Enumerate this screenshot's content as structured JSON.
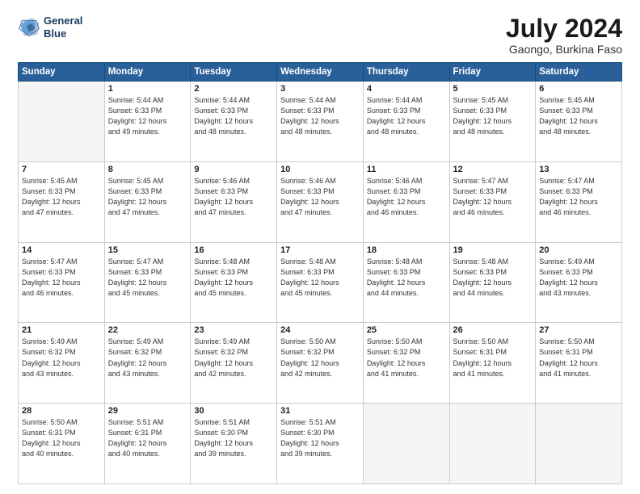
{
  "header": {
    "logo_line1": "General",
    "logo_line2": "Blue",
    "title": "July 2024",
    "subtitle": "Gaongo, Burkina Faso"
  },
  "calendar": {
    "headers": [
      "Sunday",
      "Monday",
      "Tuesday",
      "Wednesday",
      "Thursday",
      "Friday",
      "Saturday"
    ],
    "rows": [
      [
        {
          "day": "",
          "info": ""
        },
        {
          "day": "1",
          "info": "Sunrise: 5:44 AM\nSunset: 6:33 PM\nDaylight: 12 hours\nand 49 minutes."
        },
        {
          "day": "2",
          "info": "Sunrise: 5:44 AM\nSunset: 6:33 PM\nDaylight: 12 hours\nand 48 minutes."
        },
        {
          "day": "3",
          "info": "Sunrise: 5:44 AM\nSunset: 6:33 PM\nDaylight: 12 hours\nand 48 minutes."
        },
        {
          "day": "4",
          "info": "Sunrise: 5:44 AM\nSunset: 6:33 PM\nDaylight: 12 hours\nand 48 minutes."
        },
        {
          "day": "5",
          "info": "Sunrise: 5:45 AM\nSunset: 6:33 PM\nDaylight: 12 hours\nand 48 minutes."
        },
        {
          "day": "6",
          "info": "Sunrise: 5:45 AM\nSunset: 6:33 PM\nDaylight: 12 hours\nand 48 minutes."
        }
      ],
      [
        {
          "day": "7",
          "info": "Sunrise: 5:45 AM\nSunset: 6:33 PM\nDaylight: 12 hours\nand 47 minutes."
        },
        {
          "day": "8",
          "info": "Sunrise: 5:45 AM\nSunset: 6:33 PM\nDaylight: 12 hours\nand 47 minutes."
        },
        {
          "day": "9",
          "info": "Sunrise: 5:46 AM\nSunset: 6:33 PM\nDaylight: 12 hours\nand 47 minutes."
        },
        {
          "day": "10",
          "info": "Sunrise: 5:46 AM\nSunset: 6:33 PM\nDaylight: 12 hours\nand 47 minutes."
        },
        {
          "day": "11",
          "info": "Sunrise: 5:46 AM\nSunset: 6:33 PM\nDaylight: 12 hours\nand 46 minutes."
        },
        {
          "day": "12",
          "info": "Sunrise: 5:47 AM\nSunset: 6:33 PM\nDaylight: 12 hours\nand 46 minutes."
        },
        {
          "day": "13",
          "info": "Sunrise: 5:47 AM\nSunset: 6:33 PM\nDaylight: 12 hours\nand 46 minutes."
        }
      ],
      [
        {
          "day": "14",
          "info": "Sunrise: 5:47 AM\nSunset: 6:33 PM\nDaylight: 12 hours\nand 46 minutes."
        },
        {
          "day": "15",
          "info": "Sunrise: 5:47 AM\nSunset: 6:33 PM\nDaylight: 12 hours\nand 45 minutes."
        },
        {
          "day": "16",
          "info": "Sunrise: 5:48 AM\nSunset: 6:33 PM\nDaylight: 12 hours\nand 45 minutes."
        },
        {
          "day": "17",
          "info": "Sunrise: 5:48 AM\nSunset: 6:33 PM\nDaylight: 12 hours\nand 45 minutes."
        },
        {
          "day": "18",
          "info": "Sunrise: 5:48 AM\nSunset: 6:33 PM\nDaylight: 12 hours\nand 44 minutes."
        },
        {
          "day": "19",
          "info": "Sunrise: 5:48 AM\nSunset: 6:33 PM\nDaylight: 12 hours\nand 44 minutes."
        },
        {
          "day": "20",
          "info": "Sunrise: 5:49 AM\nSunset: 6:33 PM\nDaylight: 12 hours\nand 43 minutes."
        }
      ],
      [
        {
          "day": "21",
          "info": "Sunrise: 5:49 AM\nSunset: 6:32 PM\nDaylight: 12 hours\nand 43 minutes."
        },
        {
          "day": "22",
          "info": "Sunrise: 5:49 AM\nSunset: 6:32 PM\nDaylight: 12 hours\nand 43 minutes."
        },
        {
          "day": "23",
          "info": "Sunrise: 5:49 AM\nSunset: 6:32 PM\nDaylight: 12 hours\nand 42 minutes."
        },
        {
          "day": "24",
          "info": "Sunrise: 5:50 AM\nSunset: 6:32 PM\nDaylight: 12 hours\nand 42 minutes."
        },
        {
          "day": "25",
          "info": "Sunrise: 5:50 AM\nSunset: 6:32 PM\nDaylight: 12 hours\nand 41 minutes."
        },
        {
          "day": "26",
          "info": "Sunrise: 5:50 AM\nSunset: 6:31 PM\nDaylight: 12 hours\nand 41 minutes."
        },
        {
          "day": "27",
          "info": "Sunrise: 5:50 AM\nSunset: 6:31 PM\nDaylight: 12 hours\nand 41 minutes."
        }
      ],
      [
        {
          "day": "28",
          "info": "Sunrise: 5:50 AM\nSunset: 6:31 PM\nDaylight: 12 hours\nand 40 minutes."
        },
        {
          "day": "29",
          "info": "Sunrise: 5:51 AM\nSunset: 6:31 PM\nDaylight: 12 hours\nand 40 minutes."
        },
        {
          "day": "30",
          "info": "Sunrise: 5:51 AM\nSunset: 6:30 PM\nDaylight: 12 hours\nand 39 minutes."
        },
        {
          "day": "31",
          "info": "Sunrise: 5:51 AM\nSunset: 6:30 PM\nDaylight: 12 hours\nand 39 minutes."
        },
        {
          "day": "",
          "info": ""
        },
        {
          "day": "",
          "info": ""
        },
        {
          "day": "",
          "info": ""
        }
      ]
    ]
  }
}
